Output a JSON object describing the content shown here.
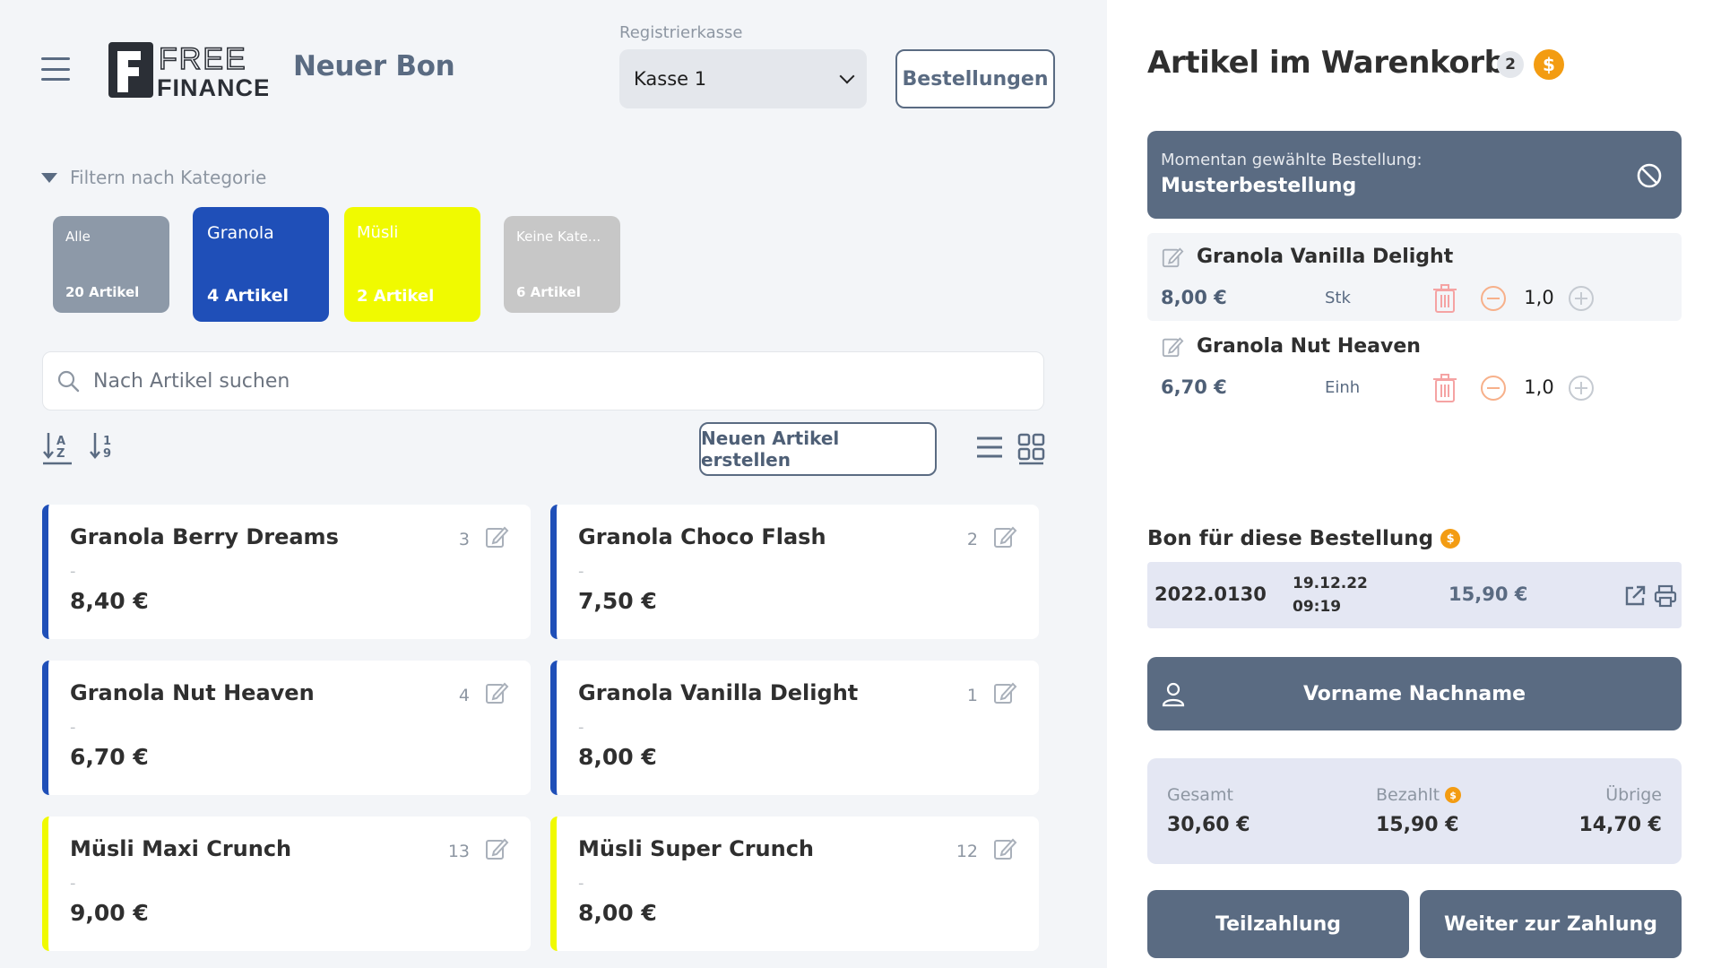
{
  "header": {
    "page_title": "Neuer Bon",
    "logo_text_top": "FREE",
    "logo_text_bottom": "FINANCE",
    "register_label": "Registrierkasse",
    "register_value": "Kasse 1",
    "orders_button": "Bestellungen"
  },
  "filter": {
    "label": "Filtern nach Kategorie",
    "categories": [
      {
        "name": "Alle",
        "count": "20 Artikel",
        "color": "#8d99a8"
      },
      {
        "name": "Granola",
        "count": "4 Artikel",
        "color": "#1f4fb8"
      },
      {
        "name": "Müsli",
        "count": "2 Artikel",
        "color": "#f0fa00"
      },
      {
        "name": "Keine Kate...",
        "count": "6 Artikel",
        "color": "#c7c7c7"
      }
    ]
  },
  "search": {
    "placeholder": "Nach Artikel suchen"
  },
  "toolbar": {
    "new_article_button": "Neuen Artikel erstellen"
  },
  "articles": [
    {
      "name": "Granola Berry Dreams",
      "qty": "3",
      "desc": "-",
      "price": "8,40 €",
      "category_color": "#1f4fb8"
    },
    {
      "name": "Granola Choco Flash",
      "qty": "2",
      "desc": "-",
      "price": "7,50 €",
      "category_color": "#1f4fb8"
    },
    {
      "name": "Granola Nut Heaven",
      "qty": "4",
      "desc": "-",
      "price": "6,70 €",
      "category_color": "#1f4fb8"
    },
    {
      "name": "Granola Vanilla Delight",
      "qty": "1",
      "desc": "-",
      "price": "8,00 €",
      "category_color": "#1f4fb8"
    },
    {
      "name": "Müsli Maxi Crunch",
      "qty": "13",
      "desc": "-",
      "price": "9,00 €",
      "category_color": "#f0fa00"
    },
    {
      "name": "Müsli Super Crunch",
      "qty": "12",
      "desc": "-",
      "price": "8,00 €",
      "category_color": "#f0fa00"
    }
  ],
  "cart": {
    "title": "Artikel im Warenkorb",
    "count": "2",
    "coin_symbol": "$",
    "current_order_label": "Momentan gewählte Bestellung:",
    "current_order_value": "Musterbestellung",
    "items": [
      {
        "name": "Granola Vanilla Delight",
        "price": "8,00 €",
        "unit": "Stk",
        "qty": "1,0"
      },
      {
        "name": "Granola Nut Heaven",
        "price": "6,70 €",
        "unit": "Einh",
        "qty": "1,0"
      }
    ]
  },
  "receipt": {
    "title": "Bon für diese Bestellung",
    "number": "2022.0130",
    "date": "19.12.22",
    "time": "09:19",
    "amount": "15,90 €"
  },
  "customer": {
    "name": "Vorname Nachname"
  },
  "totals": {
    "total_label": "Gesamt",
    "total_value": "30,60 €",
    "paid_label": "Bezahlt",
    "paid_value": "15,90 €",
    "remaining_label": "Übrige",
    "remaining_value": "14,70 €"
  },
  "actions": {
    "partial_payment": "Teilzahlung",
    "continue_payment": "Weiter zur Zahlung"
  },
  "colors": {
    "primary": "#5a6b82",
    "granola": "#1f4fb8",
    "musli": "#f0fa00",
    "coin": "#f39c12",
    "danger_soft": "#f5a3a3",
    "warn_soft": "#f7b08a"
  }
}
